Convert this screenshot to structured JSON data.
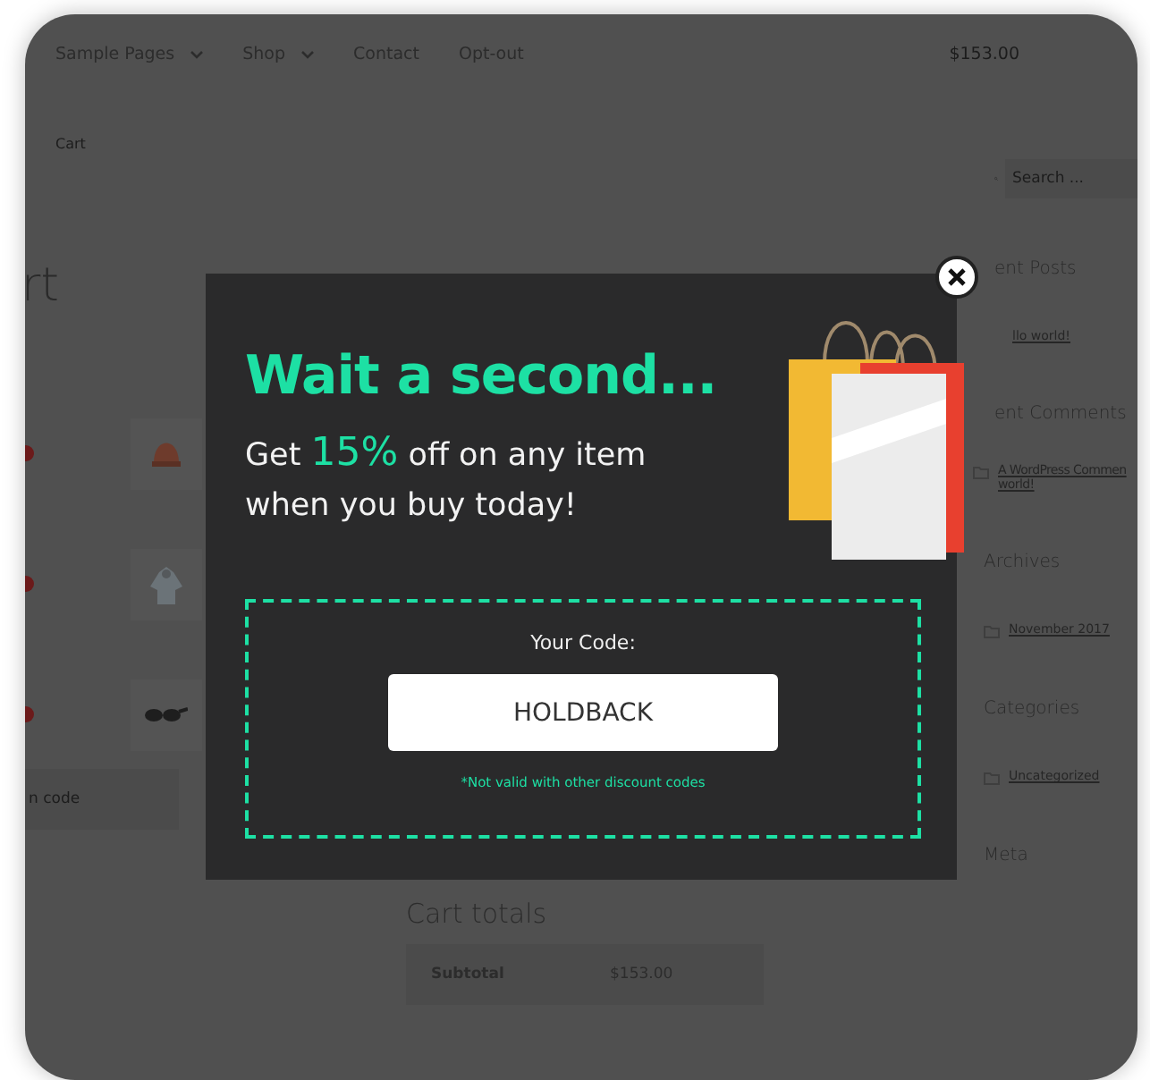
{
  "nav": {
    "items": [
      {
        "label": "Sample Pages",
        "has_submenu": true
      },
      {
        "label": "Shop",
        "has_submenu": true
      },
      {
        "label": "Contact",
        "has_submenu": false
      },
      {
        "label": "Opt-out",
        "has_submenu": false
      }
    ],
    "cart_total": "$153.00"
  },
  "breadcrumb": "Cart",
  "page_heading": "rt",
  "cart_items": [
    {
      "kind": "hat"
    },
    {
      "kind": "hoodie"
    },
    {
      "kind": "sunglasses"
    }
  ],
  "coupon": {
    "placeholder": "n code"
  },
  "cart_totals": {
    "title": "Cart totals",
    "rows": [
      {
        "label": "Subtotal",
        "value": "$153.00"
      }
    ]
  },
  "sidebar": {
    "search": {
      "placeholder": "Search ..."
    },
    "widgets": [
      {
        "title": "ent Posts",
        "links": [
          [
            "llo world!"
          ]
        ]
      },
      {
        "title": "ent Comments",
        "links": [
          [
            "A WordPress Commen",
            "world!"
          ]
        ]
      },
      {
        "title": "Archives",
        "links": [
          [
            "November 2017"
          ]
        ]
      },
      {
        "title": "Categories",
        "links": [
          [
            "Uncategorized"
          ]
        ]
      },
      {
        "title": "Meta"
      }
    ]
  },
  "popup": {
    "title": "Wait a second...",
    "offer_lead": "Get",
    "offer_highlight": "15%",
    "offer_rest": "off on any item when you buy today!",
    "code_label": "Your Code:",
    "code": "HOLDBACK",
    "note": "*Not valid with other discount codes"
  }
}
